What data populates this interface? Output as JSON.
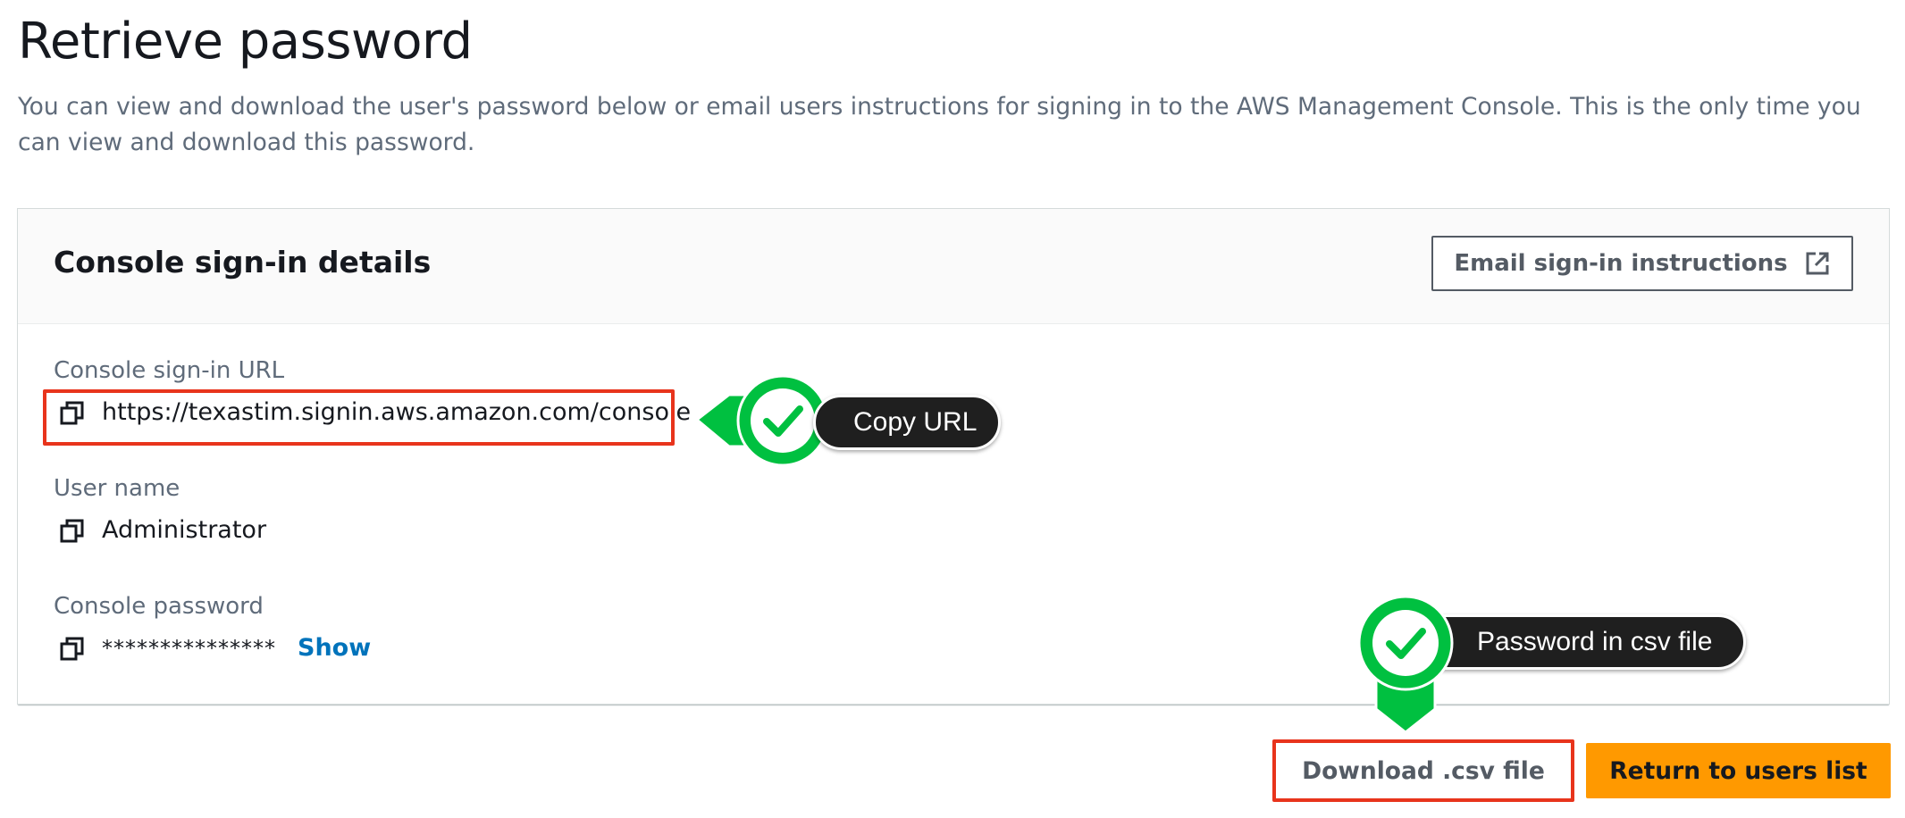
{
  "page": {
    "title": "Retrieve password",
    "description": "You can view and download the user's password below or email users instructions for signing in to the AWS Management Console. This is the only time you can view and download this password."
  },
  "panel": {
    "title": "Console sign-in details",
    "email_button": {
      "label": "Email sign-in instructions",
      "icon": "external-link-icon"
    }
  },
  "fields": {
    "url": {
      "label": "Console sign-in URL",
      "value": "https://texastim.signin.aws.amazon.com/console",
      "icon": "copy-icon"
    },
    "username": {
      "label": "User name",
      "value": "Administrator",
      "icon": "copy-icon"
    },
    "password": {
      "label": "Console password",
      "value": "***************",
      "show_label": "Show",
      "icon": "copy-icon"
    }
  },
  "actions": {
    "download_label": "Download .csv file",
    "return_label": "Return to users list"
  },
  "callouts": {
    "copy_url": "Copy URL",
    "password_csv": "Password in csv file"
  },
  "colors": {
    "accent_orange": "#ff9900",
    "link_blue": "#0073bb",
    "highlight_red": "#e8341c",
    "callout_green": "#00c040",
    "callout_dark": "#1f1f1f"
  }
}
